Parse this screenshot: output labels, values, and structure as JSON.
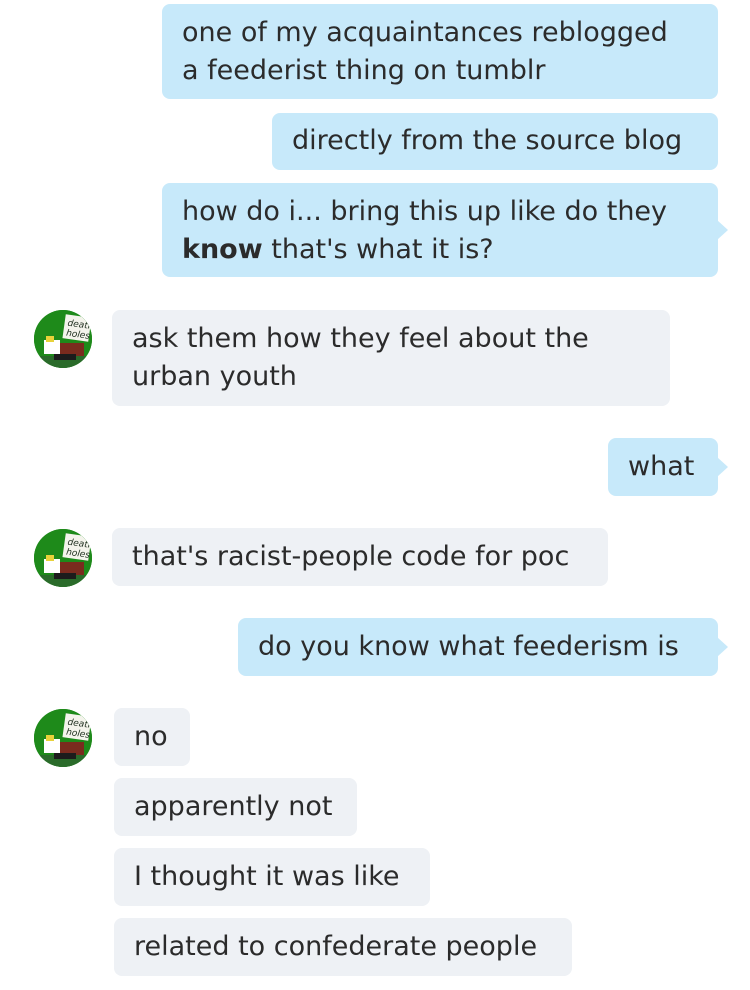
{
  "conversation": {
    "contact_avatar_text": [
      "death",
      "holes"
    ],
    "messages": [
      {
        "sender": "me",
        "lines": [
          "one of my acquaintances reblogged",
          "a feederist thing on tumblr"
        ]
      },
      {
        "sender": "me",
        "lines": [
          "directly from the source blog"
        ]
      },
      {
        "sender": "me",
        "line1": "how do i... bring this up like do they",
        "bold": "know",
        "rest": " that's what it is?"
      },
      {
        "sender": "them",
        "lines": [
          "ask them how they feel about the",
          "urban youth"
        ]
      },
      {
        "sender": "me",
        "lines": [
          "what"
        ]
      },
      {
        "sender": "them",
        "lines": [
          "that's racist-people code for poc"
        ]
      },
      {
        "sender": "me",
        "lines": [
          "do you know what feederism is"
        ]
      },
      {
        "sender": "them",
        "lines": [
          "no"
        ]
      },
      {
        "sender": "them",
        "lines": [
          "apparently not"
        ]
      },
      {
        "sender": "them",
        "lines": [
          "I thought it was like"
        ]
      },
      {
        "sender": "them",
        "lines": [
          "related to confederate people"
        ]
      }
    ]
  },
  "colors": {
    "outgoing_bubble": "#c7e9fa",
    "incoming_bubble": "#eef1f5",
    "avatar_bg": "#1e8a1a"
  }
}
